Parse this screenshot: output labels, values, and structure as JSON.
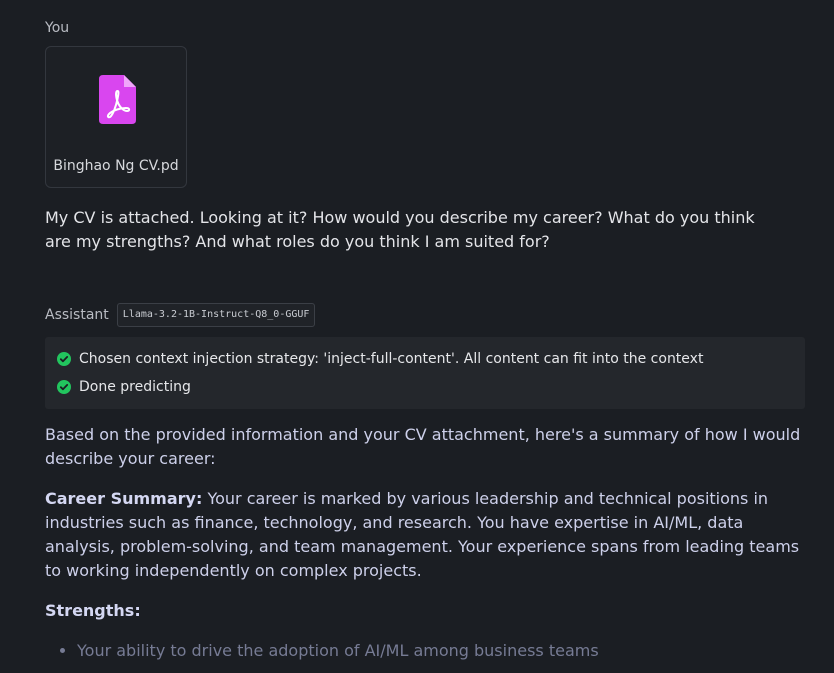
{
  "user": {
    "label": "You",
    "attachment": {
      "icon": "pdf-file-icon",
      "icon_color": "#d946ef",
      "filename": "Binghao Ng CV.pd"
    },
    "message": "My CV is attached. Looking at it? How would you describe my career? What do you think are my strengths? And what roles do you think I am suited for?"
  },
  "assistant": {
    "label": "Assistant",
    "model": "Llama-3.2-1B-Instruct-Q8_0-GGUF",
    "status": [
      {
        "icon": "check-circle-icon",
        "text": "Chosen context injection strategy: 'inject-full-content'. All content can fit into the context"
      },
      {
        "icon": "check-circle-icon",
        "text": "Done predicting"
      }
    ],
    "status_color": "#22c55e",
    "response": {
      "intro": "Based on the provided information and your CV attachment, here's a summary of how I would describe your career:",
      "career_summary_label": "Career Summary:",
      "career_summary_text": " Your career is marked by various leadership and technical positions in industries such as finance, technology, and research. You have expertise in AI/ML, data analysis, problem-solving, and team management. Your experience spans from leading teams to working independently on complex projects.",
      "strengths_label": "Strengths:",
      "strengths": [
        "Your ability to drive the adoption of AI/ML among business teams"
      ]
    }
  }
}
